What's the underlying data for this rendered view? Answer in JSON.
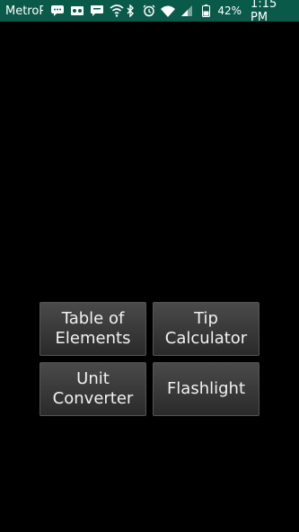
{
  "status_bar": {
    "carrier": "MetroPCS",
    "battery_percent": "42%",
    "time": "1:15 PM",
    "icons_left": [
      "message-icon",
      "voicemail-icon",
      "chat-icon",
      "shield-wifi-icon"
    ],
    "icons_right": [
      "bluetooth-icon",
      "alarm-icon",
      "wifi-icon",
      "signal-icon",
      "battery-icon"
    ]
  },
  "buttons": [
    {
      "label": "Table of\nElements"
    },
    {
      "label": "Tip\nCalculator"
    },
    {
      "label": "Unit\nConverter"
    },
    {
      "label": "Flashlight"
    }
  ],
  "colors": {
    "status_bar": "#0a5a4a",
    "background": "#000000"
  }
}
